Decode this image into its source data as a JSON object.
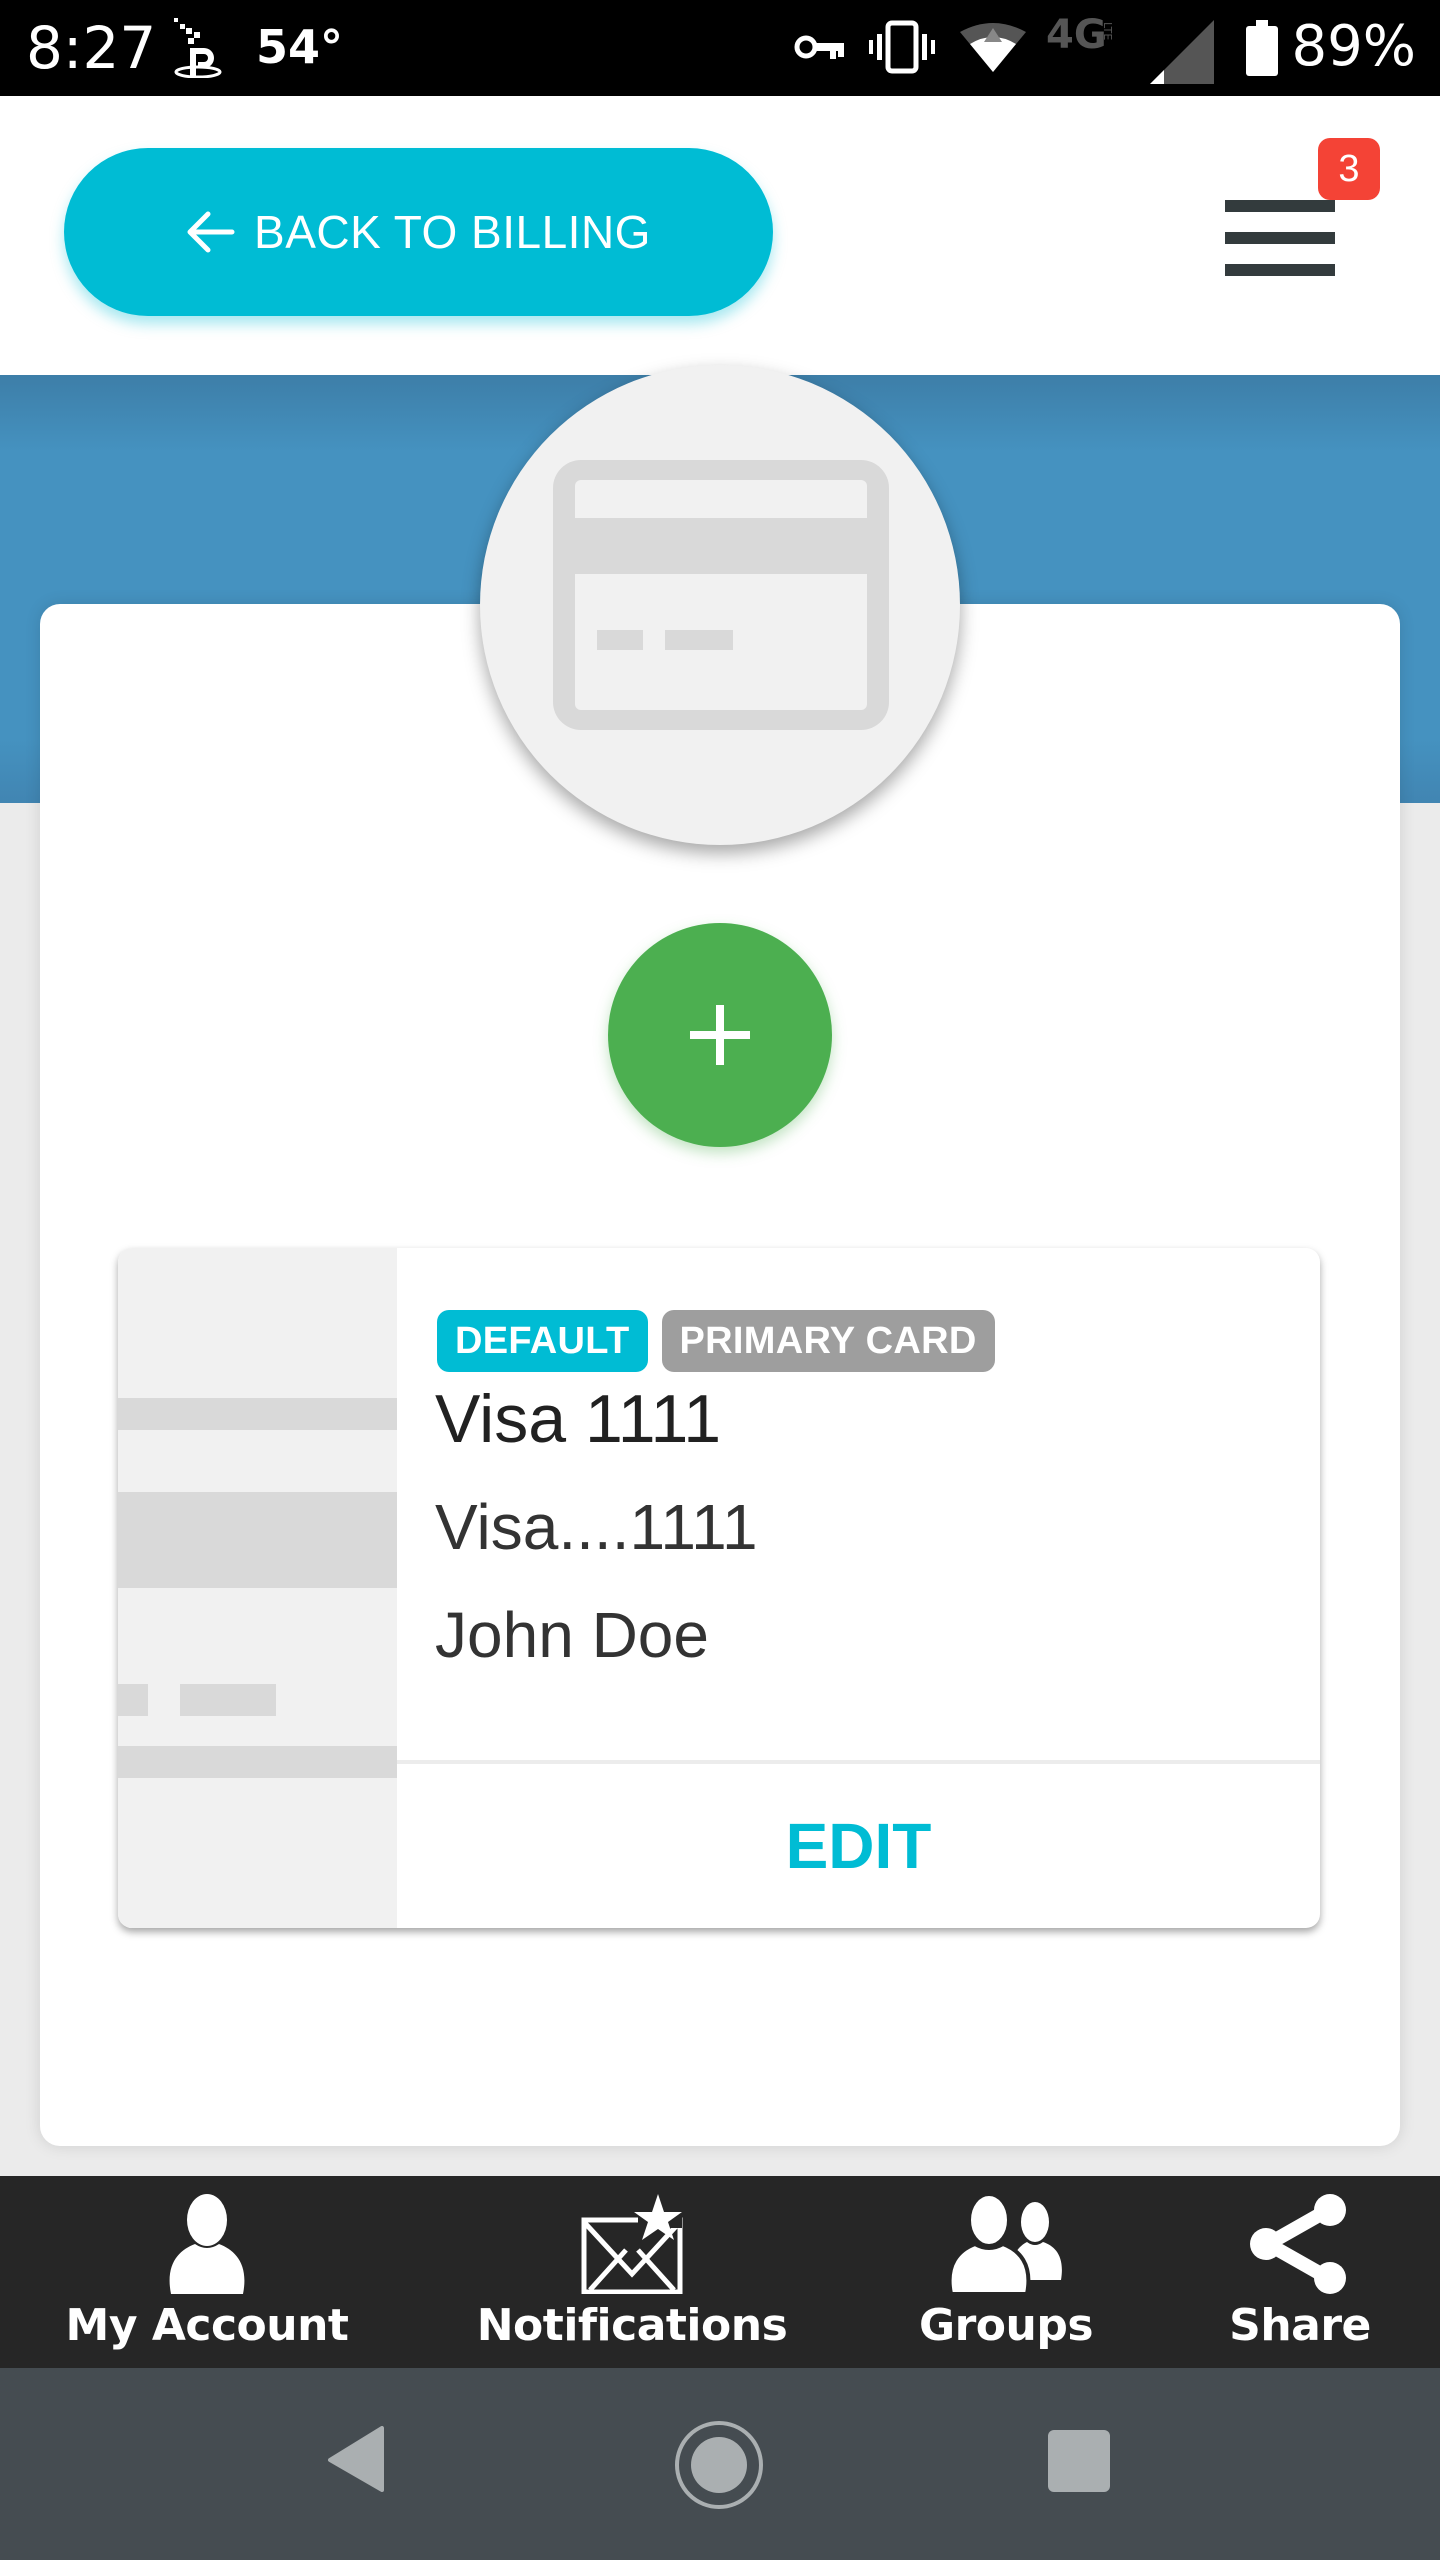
{
  "status_bar": {
    "time": "8:27",
    "temperature": "54°",
    "battery_percent": "89%",
    "network_type": "4G LTE",
    "icons": [
      "pixel-app-icon",
      "vpn-key-icon",
      "vibrate-icon",
      "wifi-icon",
      "lte-icon",
      "signal-icon",
      "battery-icon"
    ]
  },
  "header": {
    "back_button_label": "BACK TO BILLING",
    "back_icon": "arrow-left-icon",
    "menu_icon": "hamburger-menu-icon",
    "notification_count": "3"
  },
  "colors": {
    "accent": "#00bcd4",
    "header_band": "#4592c0",
    "add_button": "#4caf50",
    "badge_red": "#f44336",
    "badge_gray": "#9e9e9e",
    "bottom_nav": "#262626",
    "system_nav": "#454c51"
  },
  "main": {
    "hero_icon": "credit-card-icon",
    "add_icon": "plus-icon",
    "cards": [
      {
        "badges": [
          "DEFAULT",
          "PRIMARY CARD"
        ],
        "title": "Visa 1111",
        "masked_number": "Visa....1111",
        "holder_name": "John Doe",
        "edit_label": "EDIT"
      }
    ]
  },
  "bottom_nav": {
    "items": [
      {
        "label": "My Account",
        "icon": "user-icon"
      },
      {
        "label": "Notifications",
        "icon": "envelope-star-icon"
      },
      {
        "label": "Groups",
        "icon": "group-icon"
      },
      {
        "label": "Share",
        "icon": "share-icon"
      }
    ]
  },
  "system_nav": {
    "buttons": [
      "back-triangle-icon",
      "home-circle-icon",
      "recents-square-icon"
    ]
  }
}
